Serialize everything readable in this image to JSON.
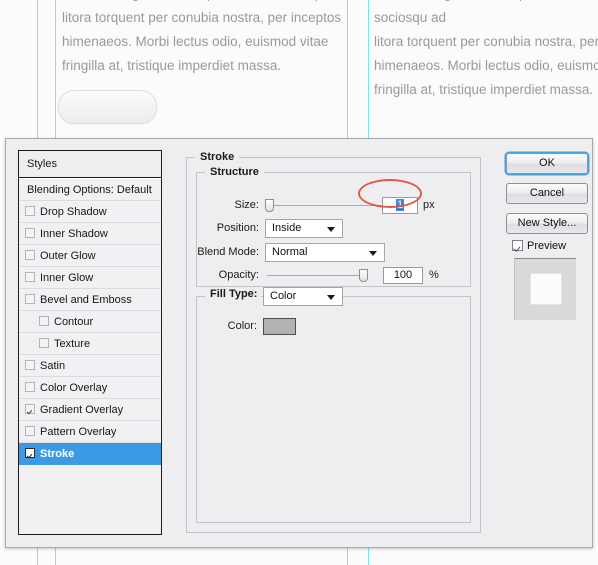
{
  "background": {
    "paragraph_left": "eleifend magna. Class aptent taciti sociosqu ad\nlitora torquent per conubia nostra, per inceptos\nhimenaeos. Morbi lectus odio, euismod vitae\nfringilla at, tristique imperdiet massa.",
    "paragraph_right": "eleifend magna. Class aptent taciti sociosqu ad\nlitora torquent per conubia nostra, per\nhimenaeos. Morbi lectus odio, euismo\nfringilla at, tristique imperdiet massa.",
    "button_label": "",
    "guide_color": "#7fe3e8"
  },
  "dialog": {
    "styles_panel": {
      "header": "Styles",
      "items": [
        {
          "label": "Blending Options: Default",
          "checkbox": false,
          "checked": false,
          "indent": false,
          "selected": false
        },
        {
          "label": "Drop Shadow",
          "checkbox": true,
          "checked": false,
          "indent": false,
          "selected": false
        },
        {
          "label": "Inner Shadow",
          "checkbox": true,
          "checked": false,
          "indent": false,
          "selected": false
        },
        {
          "label": "Outer Glow",
          "checkbox": true,
          "checked": false,
          "indent": false,
          "selected": false
        },
        {
          "label": "Inner Glow",
          "checkbox": true,
          "checked": false,
          "indent": false,
          "selected": false
        },
        {
          "label": "Bevel and Emboss",
          "checkbox": true,
          "checked": false,
          "indent": false,
          "selected": false
        },
        {
          "label": "Contour",
          "checkbox": true,
          "checked": false,
          "indent": true,
          "selected": false
        },
        {
          "label": "Texture",
          "checkbox": true,
          "checked": false,
          "indent": true,
          "selected": false
        },
        {
          "label": "Satin",
          "checkbox": true,
          "checked": false,
          "indent": false,
          "selected": false
        },
        {
          "label": "Color Overlay",
          "checkbox": true,
          "checked": false,
          "indent": false,
          "selected": false
        },
        {
          "label": "Gradient Overlay",
          "checkbox": true,
          "checked": true,
          "indent": false,
          "selected": false
        },
        {
          "label": "Pattern Overlay",
          "checkbox": true,
          "checked": false,
          "indent": false,
          "selected": false
        },
        {
          "label": "Stroke",
          "checkbox": true,
          "checked": true,
          "indent": false,
          "selected": true
        }
      ],
      "selection_color": "#3c9ae4"
    },
    "stroke": {
      "group_title": "Stroke",
      "structure": {
        "group_title": "Structure",
        "size": {
          "label": "Size:",
          "value": "1",
          "unit": "px",
          "slider_percent": 2,
          "value_selected": true
        },
        "position": {
          "label": "Position:",
          "value": "Inside"
        },
        "blend_mode": {
          "label": "Blend Mode:",
          "value": "Normal"
        },
        "opacity": {
          "label": "Opacity:",
          "value": "100",
          "unit": "%",
          "slider_percent": 100
        }
      },
      "fill": {
        "fill_type_label": "Fill Type:",
        "fill_type_value": "Color",
        "color_label": "Color:",
        "color_value": "#b2b2b2"
      }
    },
    "buttons": {
      "ok": "OK",
      "cancel": "Cancel",
      "new_style": "New Style...",
      "preview_label": "Preview",
      "preview_checked": true
    },
    "annotation": {
      "type": "ellipse-highlight",
      "color": "#d9503c",
      "target": "size-value-field"
    }
  }
}
